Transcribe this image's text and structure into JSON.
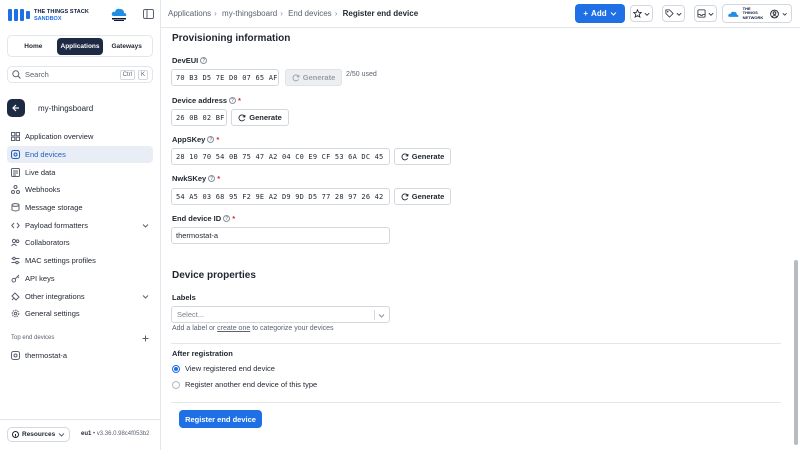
{
  "logo": {
    "line1": "THE THINGS STACK",
    "line2": "SANDBOX"
  },
  "sidebar": {
    "tabs": [
      {
        "label": "Home"
      },
      {
        "label": "Applications"
      },
      {
        "label": "Gateways"
      }
    ],
    "search": {
      "placeholder": "Search",
      "shortcut_key1": "Ctrl",
      "shortcut_key2": "K"
    },
    "app_name": "my-thingsboard",
    "items": [
      {
        "label": "Application overview",
        "icon": "grid-icon"
      },
      {
        "label": "End devices",
        "icon": "device-icon"
      },
      {
        "label": "Live data",
        "icon": "list-icon"
      },
      {
        "label": "Webhooks",
        "icon": "webhook-icon"
      },
      {
        "label": "Message storage",
        "icon": "database-icon"
      },
      {
        "label": "Payload formatters",
        "icon": "code-icon"
      },
      {
        "label": "Collaborators",
        "icon": "people-icon"
      },
      {
        "label": "MAC settings profiles",
        "icon": "sliders-icon"
      },
      {
        "label": "API keys",
        "icon": "key-icon"
      },
      {
        "label": "Other integrations",
        "icon": "integrations-icon"
      },
      {
        "label": "General settings",
        "icon": "gear-icon"
      }
    ],
    "top_devices_label": "Top end devices",
    "top_devices": [
      {
        "label": "thermostat-a"
      }
    ],
    "resources_label": "Resources",
    "cluster": "eu1",
    "version": "v3.36.0.98c4f053b2"
  },
  "header": {
    "breadcrumb": [
      "Applications",
      "my-thingsboard",
      "End devices",
      "Register end device"
    ],
    "add_label": "Add",
    "user_logo_line1": "THE THINGS",
    "user_logo_line2": "NETWORK"
  },
  "form": {
    "provisioning_title": "Provisioning information",
    "deveui": {
      "label": "DevEUI",
      "value": "70 B3 D5 7E D0 07 65 AF",
      "generate_label": "Generate",
      "used_text": "2/50 used"
    },
    "device_address": {
      "label": "Device address",
      "value": "26 0B 02 BF",
      "generate_label": "Generate"
    },
    "appskey": {
      "label": "AppSKey",
      "value": "28 10 70 54 0B 75 47 A2 04 C0 E9 CF 53 6A DC 45",
      "generate_label": "Generate"
    },
    "nwkskey": {
      "label": "NwkSKey",
      "value": "54 A5 03 68 95 F2 9E A2 D9 9D D5 77 28 97 26 42",
      "generate_label": "Generate"
    },
    "end_device_id": {
      "label": "End device ID",
      "value": "thermostat-a"
    },
    "device_properties_title": "Device properties",
    "labels": {
      "label": "Labels",
      "placeholder": "Select...",
      "hint_before": "Add a label or ",
      "hint_link": "create one",
      "hint_after": " to categorize your devices"
    },
    "after_registration": {
      "label": "After registration",
      "options": [
        {
          "label": "View registered end device",
          "checked": true
        },
        {
          "label": "Register another end device of this type",
          "checked": false
        }
      ]
    },
    "submit_label": "Register end device"
  },
  "colors": {
    "primary": "#1f6fe5",
    "nav_dark": "#1d2a44",
    "active_bg": "#e9eef6",
    "required": "#d9253b"
  }
}
